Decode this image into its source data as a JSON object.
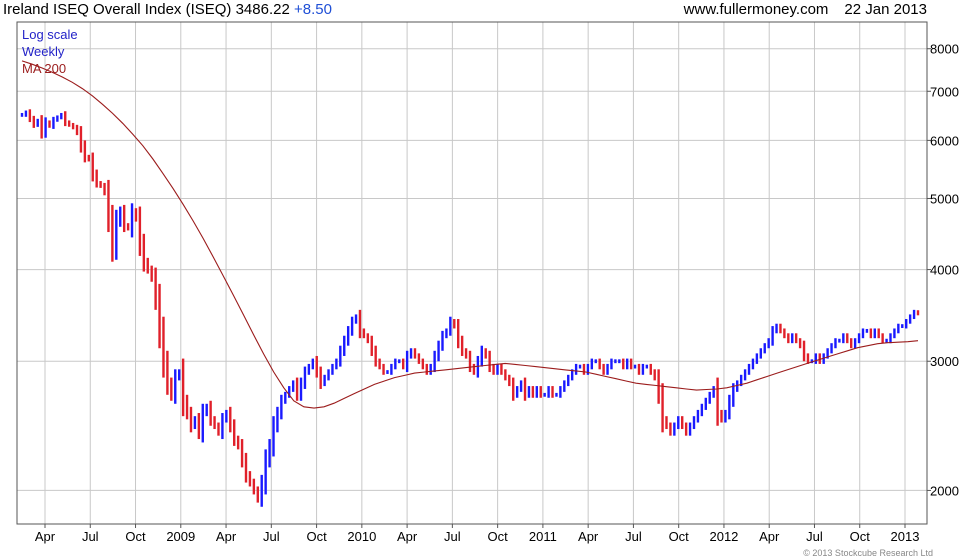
{
  "header": {
    "title": "Ireland ISEQ Overall Index (ISEQ)",
    "last": "3486.22",
    "change": "+8.50",
    "source": "www.fullermoney.com",
    "date": "22 Jan 2013"
  },
  "legend": {
    "scale": "Log scale",
    "period": "Weekly",
    "ma": "MA 200"
  },
  "copyright": "© 2013 Stockcube Research Ltd",
  "colors": {
    "up": "#1a1aff",
    "down": "#e0202a",
    "ma": "#9b1c1c",
    "grid": "#c8c8c8",
    "legend": "#2323c8"
  },
  "chart_data": {
    "type": "line",
    "subtype": "weekly ohlc bars with 200-period moving average",
    "title": "Ireland ISEQ Overall Index (ISEQ)",
    "yscale": "log",
    "ylim": [
      1800,
      8700
    ],
    "y_ticks": [
      2000,
      3000,
      4000,
      5000,
      6000,
      7000,
      8000
    ],
    "x_ticks": [
      "Apr",
      "Jul",
      "Oct",
      "2009",
      "Apr",
      "Jul",
      "Oct",
      "2010",
      "Apr",
      "Jul",
      "Oct",
      "2011",
      "Apr",
      "Jul",
      "Oct",
      "2012",
      "Apr",
      "Jul",
      "Oct",
      "2013"
    ],
    "grid": true,
    "series": [
      {
        "name": "ISEQ",
        "close": [
          6500,
          6550,
          6420,
          6300,
          6380,
          6150,
          6350,
          6280,
          6400,
          6450,
          6500,
          6350,
          6300,
          6250,
          6150,
          5900,
          5700,
          5650,
          5400,
          5250,
          5200,
          5100,
          4700,
          4300,
          4650,
          4800,
          4600,
          4550,
          4800,
          4700,
          4350,
          4100,
          4000,
          3900,
          3650,
          3300,
          3000,
          2800,
          2700,
          2850,
          2900,
          2650,
          2550,
          2450,
          2500,
          2400,
          2550,
          2600,
          2500,
          2450,
          2400,
          2500,
          2550,
          2450,
          2350,
          2300,
          2200,
          2100,
          2050,
          2000,
          1950,
          2050,
          2200,
          2300,
          2450,
          2550,
          2650,
          2700,
          2750,
          2800,
          2700,
          2800,
          2900,
          2950,
          3000,
          2900,
          2800,
          2850,
          2900,
          2950,
          3000,
          3100,
          3200,
          3300,
          3400,
          3450,
          3300,
          3250,
          3200,
          3100,
          3000,
          2950,
          2900,
          2900,
          2950,
          3000,
          3000,
          2950,
          3050,
          3100,
          3050,
          3000,
          2950,
          2900,
          2950,
          3050,
          3150,
          3250,
          3300,
          3400,
          3350,
          3200,
          3100,
          3050,
          2950,
          2900,
          3000,
          3100,
          3050,
          2950,
          2900,
          2950,
          2900,
          2850,
          2800,
          2700,
          2750,
          2800,
          2700,
          2750,
          2700,
          2750,
          2700,
          2700,
          2750,
          2700,
          2700,
          2750,
          2800,
          2850,
          2900,
          2950,
          2950,
          2900,
          2950,
          3000,
          3000,
          2950,
          2900,
          2950,
          3000,
          3000,
          3000,
          2950,
          3000,
          2950,
          2950,
          2900,
          2950,
          2950,
          2900,
          2850,
          2700,
          2500,
          2450,
          2400,
          2450,
          2500,
          2450,
          2400,
          2450,
          2500,
          2550,
          2600,
          2650,
          2700,
          2750,
          2550,
          2500,
          2550,
          2650,
          2750,
          2800,
          2850,
          2900,
          2950,
          3000,
          3050,
          3100,
          3150,
          3200,
          3300,
          3350,
          3300,
          3250,
          3200,
          3250,
          3200,
          3150,
          3050,
          3000,
          3000,
          3050,
          3000,
          3050,
          3100,
          3150,
          3200,
          3200,
          3250,
          3200,
          3150,
          3200,
          3250,
          3300,
          3300,
          3250,
          3300,
          3250,
          3200,
          3200,
          3250,
          3300,
          3350,
          3350,
          3400,
          3450,
          3500,
          3486
        ]
      },
      {
        "name": "MA 200",
        "values": [
          7700,
          7620,
          7530,
          7430,
          7320,
          7200,
          7060,
          6900,
          6720,
          6530,
          6330,
          6120,
          5900,
          5660,
          5410,
          5160,
          4910,
          4660,
          4410,
          4160,
          3920,
          3690,
          3470,
          3260,
          3070,
          2900,
          2760,
          2650,
          2600,
          2590,
          2600,
          2630,
          2670,
          2710,
          2750,
          2790,
          2820,
          2850,
          2870,
          2890,
          2900,
          2910,
          2920,
          2930,
          2940,
          2950,
          2960,
          2970,
          2980,
          2970,
          2960,
          2950,
          2940,
          2930,
          2920,
          2910,
          2900,
          2880,
          2860,
          2840,
          2820,
          2800,
          2790,
          2780,
          2770,
          2760,
          2750,
          2740,
          2745,
          2750,
          2760,
          2780,
          2800,
          2830,
          2860,
          2890,
          2920,
          2950,
          2980,
          3010,
          3040,
          3070,
          3100,
          3130,
          3150,
          3170,
          3180,
          3185,
          3190,
          3200
        ]
      }
    ]
  }
}
